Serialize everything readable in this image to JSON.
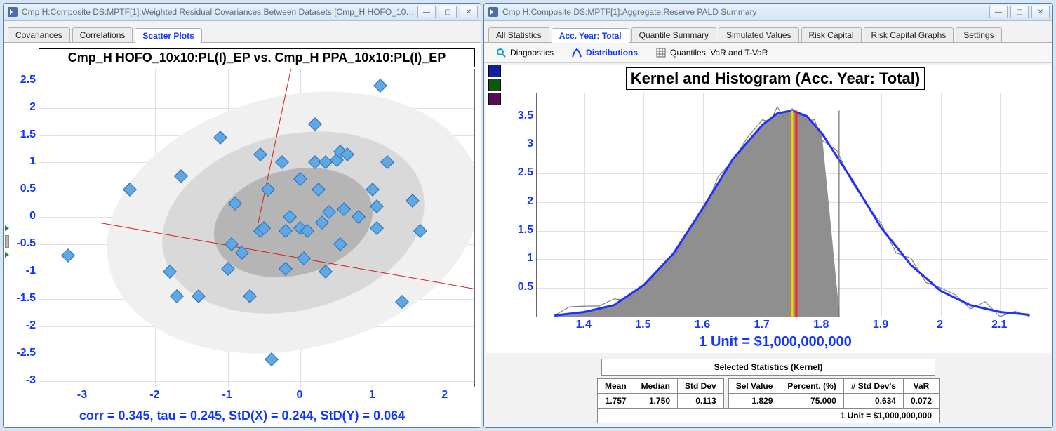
{
  "left_window": {
    "title": "Cmp H:Composite DS:MPTF[1]:Weighted Residual Covariances Between Datasets [Cmp_H HOFO_10x...",
    "tabs": [
      "Covariances",
      "Correlations",
      "Scatter Plots"
    ],
    "active_tab": 2
  },
  "right_window": {
    "title": "Cmp H:Composite DS:MPTF[1]:Aggregate:Reserve PALD Summary",
    "tabs": [
      "All Statistics",
      "Acc. Year: Total",
      "Quantile Summary",
      "Simulated Values",
      "Risk Capital",
      "Risk Capital Graphs",
      "Settings"
    ],
    "active_tab": 1,
    "toolbar": [
      {
        "label": "Diagnostics",
        "active": false
      },
      {
        "label": "Distributions",
        "active": true
      },
      {
        "label": "Quantiles, VaR and T-VaR",
        "active": false
      }
    ]
  },
  "scatter": {
    "title": "Cmp_H HOFO_10x10:PL(I)_EP vs. Cmp_H PPA_10x10:PL(I)_EP",
    "footer": "corr = 0.345, tau = 0.245, StD(X) = 0.244, StD(Y) = 0.064",
    "x_ticks": [
      -3,
      -2,
      -1,
      0,
      1,
      2
    ],
    "y_ticks": [
      2.5,
      2,
      1.5,
      1,
      0.5,
      0,
      -0.5,
      -1,
      -1.5,
      -2,
      -2.5,
      -3
    ],
    "x_range": [
      -3.6,
      2.4
    ],
    "y_range": [
      -3.1,
      2.7
    ]
  },
  "density": {
    "title": "Kernel and Histogram (Acc. Year: Total)",
    "unit_label": "1 Unit = $1,000,000,000",
    "x_ticks": [
      1.4,
      1.5,
      1.6,
      1.7,
      1.8,
      1.9,
      2,
      2.1
    ],
    "y_ticks": [
      0.5,
      1,
      1.5,
      2,
      2.5,
      3,
      3.5
    ],
    "x_range": [
      1.32,
      2.18
    ],
    "y_range": [
      0,
      3.9
    ]
  },
  "stats": {
    "title": "Selected Statistics (Kernel)",
    "headers_left": [
      "Mean",
      "Median",
      "Std Dev"
    ],
    "values_left": [
      "1.757",
      "1.750",
      "0.113"
    ],
    "headers_right": [
      "Sel Value",
      "Percent. (%)",
      "# Std Dev's",
      "VaR"
    ],
    "values_right": [
      "1.829",
      "75.000",
      "0.634",
      "0.072"
    ],
    "unit_row": "1 Unit = $1,000,000,000"
  },
  "chart_data": [
    {
      "type": "scatter",
      "title": "Cmp_H HOFO_10x10:PL(I)_EP vs. Cmp_H PPA_10x10:PL(I)_EP",
      "xlabel": "",
      "ylabel": "",
      "xlim": [
        -3.6,
        2.4
      ],
      "ylim": [
        -3.1,
        2.7
      ],
      "points": [
        [
          -3.2,
          -0.7
        ],
        [
          -2.35,
          0.5
        ],
        [
          -1.65,
          0.75
        ],
        [
          -1.8,
          -1.0
        ],
        [
          -1.7,
          -1.45
        ],
        [
          -1.4,
          -1.45
        ],
        [
          -1.1,
          1.45
        ],
        [
          -1.0,
          -0.95
        ],
        [
          -0.95,
          -0.5
        ],
        [
          -0.9,
          0.25
        ],
        [
          -0.8,
          -0.65
        ],
        [
          -0.7,
          -1.45
        ],
        [
          -0.55,
          -0.25
        ],
        [
          -0.55,
          1.15
        ],
        [
          -0.45,
          0.5
        ],
        [
          -0.5,
          -0.2
        ],
        [
          -0.4,
          -2.6
        ],
        [
          -0.25,
          1.0
        ],
        [
          -0.2,
          -0.25
        ],
        [
          -0.2,
          -0.95
        ],
        [
          -0.15,
          0.0
        ],
        [
          0.0,
          -0.2
        ],
        [
          0.0,
          0.7
        ],
        [
          0.05,
          -0.75
        ],
        [
          0.1,
          -0.25
        ],
        [
          0.2,
          1.7
        ],
        [
          0.2,
          1.0
        ],
        [
          0.25,
          0.5
        ],
        [
          0.3,
          -0.1
        ],
        [
          0.35,
          -1.0
        ],
        [
          0.4,
          0.1
        ],
        [
          0.5,
          1.05
        ],
        [
          0.55,
          1.2
        ],
        [
          0.55,
          -0.5
        ],
        [
          0.6,
          0.15
        ],
        [
          0.65,
          1.15
        ],
        [
          0.8,
          0.0
        ],
        [
          1.0,
          0.5
        ],
        [
          1.05,
          0.2
        ],
        [
          1.1,
          2.4
        ],
        [
          1.05,
          -0.2
        ],
        [
          1.2,
          1.0
        ],
        [
          1.4,
          -1.55
        ],
        [
          1.55,
          0.3
        ],
        [
          1.65,
          -0.25
        ],
        [
          0.35,
          1.0
        ]
      ],
      "corr": 0.345,
      "tau": 0.245,
      "stdx": 0.244,
      "stdy": 0.064,
      "ellipses": [
        {
          "level": 3,
          "fill": "#f0f0f0"
        },
        {
          "level": 2,
          "fill": "#d9d9d9"
        },
        {
          "level": 1,
          "fill": "#b5b5b5"
        }
      ],
      "regression_lines": [
        {
          "label": "y-on-x",
          "angle_deg": 12
        },
        {
          "label": "x-on-y",
          "angle_deg": 78
        }
      ]
    },
    {
      "type": "area",
      "title": "Kernel and Histogram (Acc. Year: Total)",
      "xlabel": "",
      "ylabel": "",
      "xlim": [
        1.32,
        2.18
      ],
      "ylim": [
        0,
        3.9
      ],
      "unit": "1e9 USD",
      "series": [
        {
          "name": "Kernel",
          "color": "#2030ff",
          "x": [
            1.35,
            1.4,
            1.45,
            1.5,
            1.55,
            1.6,
            1.65,
            1.7,
            1.725,
            1.75,
            1.775,
            1.8,
            1.85,
            1.9,
            1.95,
            2.0,
            2.05,
            2.1,
            2.15
          ],
          "y": [
            0.02,
            0.08,
            0.2,
            0.55,
            1.1,
            1.9,
            2.75,
            3.35,
            3.55,
            3.6,
            3.5,
            3.2,
            2.4,
            1.55,
            0.9,
            0.45,
            0.2,
            0.08,
            0.03
          ]
        }
      ],
      "fill_to_x": 1.83,
      "verticals": [
        {
          "x": 1.75,
          "color": "#ffcc00",
          "label": "median"
        },
        {
          "x": 1.757,
          "color": "#ff2020",
          "label": "mean"
        },
        {
          "x": 1.829,
          "color": "#707070",
          "label": "selected"
        }
      ]
    }
  ]
}
